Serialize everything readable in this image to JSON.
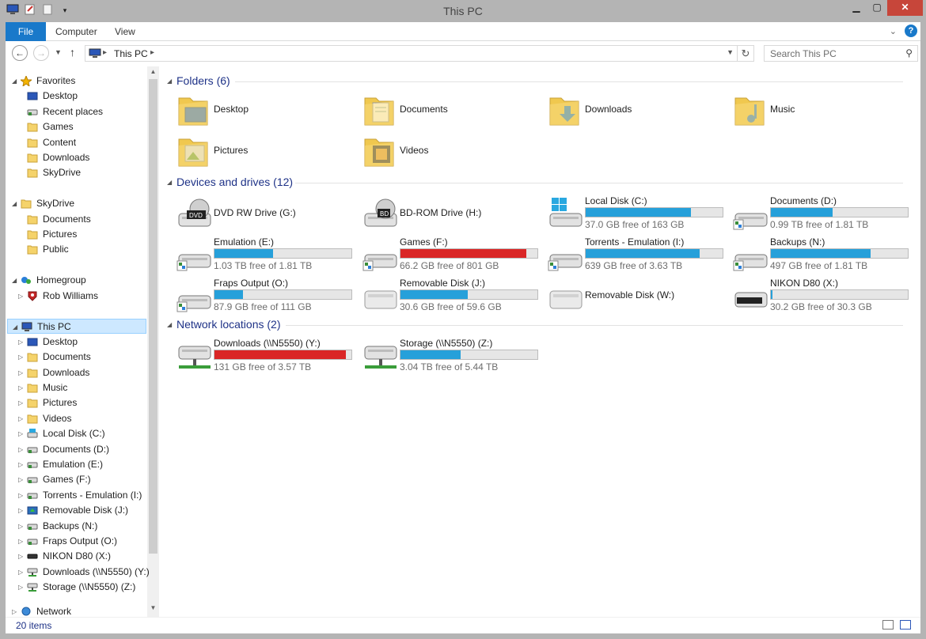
{
  "window": {
    "title": "This PC"
  },
  "ribbon": {
    "tabs": [
      "File",
      "Computer",
      "View"
    ]
  },
  "address": {
    "crumb": "This PC"
  },
  "search": {
    "placeholder": "Search This PC"
  },
  "nav": {
    "favorites": {
      "label": "Favorites",
      "items": [
        "Desktop",
        "Recent places",
        "Games",
        "Content",
        "Downloads",
        "SkyDrive"
      ]
    },
    "skydrive": {
      "label": "SkyDrive",
      "items": [
        "Documents",
        "Pictures",
        "Public"
      ]
    },
    "homegroup": {
      "label": "Homegroup",
      "items": [
        "Rob Williams"
      ]
    },
    "thispc": {
      "label": "This PC",
      "items": [
        "Desktop",
        "Documents",
        "Downloads",
        "Music",
        "Pictures",
        "Videos",
        "Local Disk (C:)",
        "Documents (D:)",
        "Emulation (E:)",
        "Games (F:)",
        "Torrents - Emulation (I:)",
        "Removable Disk (J:)",
        "Backups (N:)",
        "Fraps Output (O:)",
        "NIKON D80 (X:)",
        "Downloads (\\\\N5550) (Y:)",
        "Storage (\\\\N5550) (Z:)"
      ]
    },
    "network": {
      "label": "Network"
    }
  },
  "groups": {
    "folders": {
      "title": "Folders (6)",
      "items": [
        "Desktop",
        "Documents",
        "Downloads",
        "Music",
        "Pictures",
        "Videos"
      ]
    },
    "drives": {
      "title": "Devices and drives (12)",
      "items": [
        {
          "name": "DVD RW Drive (G:)",
          "free": "",
          "used": null,
          "icon": "dvd-drive-icon"
        },
        {
          "name": "BD-ROM Drive (H:)",
          "free": "",
          "used": null,
          "icon": "bd-drive-icon"
        },
        {
          "name": "Local Disk (C:)",
          "free": "37.0 GB free of 163 GB",
          "used": 0.77,
          "icon": "windows-drive-icon"
        },
        {
          "name": "Documents (D:)",
          "free": "0.99 TB free of 1.81 TB",
          "used": 0.45,
          "icon": "hard-drive-icon"
        },
        {
          "name": "Emulation (E:)",
          "free": "1.03 TB free of 1.81 TB",
          "used": 0.43,
          "icon": "hard-drive-icon"
        },
        {
          "name": "Games (F:)",
          "free": "66.2 GB free of 801 GB",
          "used": 0.92,
          "icon": "hard-drive-icon"
        },
        {
          "name": "Torrents - Emulation (I:)",
          "free": "639 GB free of 3.63 TB",
          "used": 0.83,
          "icon": "hard-drive-icon"
        },
        {
          "name": "Backups (N:)",
          "free": "497 GB free of 1.81 TB",
          "used": 0.73,
          "icon": "hard-drive-icon"
        },
        {
          "name": "Fraps Output (O:)",
          "free": "87.9 GB free of 111 GB",
          "used": 0.21,
          "icon": "hard-drive-icon"
        },
        {
          "name": "Removable Disk (J:)",
          "free": "30.6 GB free of 59.6 GB",
          "used": 0.49,
          "icon": "removable-disk-icon"
        },
        {
          "name": "Removable Disk (W:)",
          "free": "",
          "used": null,
          "icon": "removable-disk-icon"
        },
        {
          "name": "NIKON D80 (X:)",
          "free": "30.2 GB free of 30.3 GB",
          "used": 0.01,
          "icon": "camera-drive-icon"
        }
      ]
    },
    "network": {
      "title": "Network locations (2)",
      "items": [
        {
          "name": "Downloads (\\\\N5550) (Y:)",
          "free": "131 GB free of 3.57 TB",
          "used": 0.96,
          "icon": "network-drive-icon"
        },
        {
          "name": "Storage (\\\\N5550) (Z:)",
          "free": "3.04 TB free of 5.44 TB",
          "used": 0.44,
          "icon": "network-drive-icon"
        }
      ]
    }
  },
  "status": {
    "count": "20 items"
  },
  "colors": {
    "accent": "#1979ca",
    "bar_normal": "#26a0da",
    "bar_full": "#da2626",
    "group_title": "#1e3287"
  }
}
